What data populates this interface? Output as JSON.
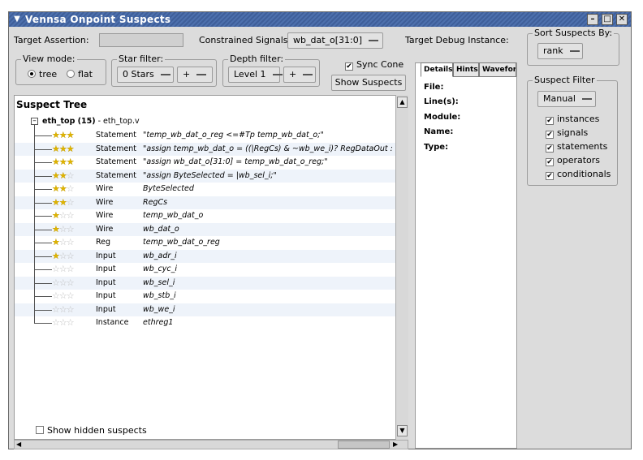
{
  "window": {
    "title": "Vennsa Onpoint Suspects"
  },
  "toolbar": {
    "target_assertion_label": "Target Assertion:",
    "constrained_signals_label": "Constrained Signals:",
    "constrained_signals_value": "wb_dat_o[31:0]",
    "target_debug_label": "Target Debug Instance:"
  },
  "view_mode": {
    "title": "View mode:",
    "tree_label": "tree",
    "flat_label": "flat"
  },
  "star_filter": {
    "title": "Star filter:",
    "value": "0 Stars",
    "op": "+"
  },
  "depth_filter": {
    "title": "Depth filter:",
    "value": "Level 1",
    "op": "+"
  },
  "sync_cone_label": "Sync Cone",
  "show_suspects_label": "Show Suspects",
  "tree": {
    "title": "Suspect Tree",
    "root_name": "eth_top (15)",
    "root_file": " - eth_top.v",
    "rows": [
      {
        "stars": 3,
        "kind": "Statement",
        "name": "\"temp_wb_dat_o_reg <=#Tp temp_wb_dat_o;\""
      },
      {
        "stars": 3,
        "kind": "Statement",
        "name": "\"assign temp_wb_dat_o = ((|RegCs) & ~wb_we_i)? RegDataOut : BD"
      },
      {
        "stars": 3,
        "kind": "Statement",
        "name": "\"assign wb_dat_o[31:0] = temp_wb_dat_o_reg;\""
      },
      {
        "stars": 2,
        "kind": "Statement",
        "name": "\"assign ByteSelected = |wb_sel_i;\""
      },
      {
        "stars": 2,
        "kind": "Wire",
        "name": "ByteSelected"
      },
      {
        "stars": 2,
        "kind": "Wire",
        "name": "RegCs"
      },
      {
        "stars": 1,
        "kind": "Wire",
        "name": "temp_wb_dat_o"
      },
      {
        "stars": 1,
        "kind": "Wire",
        "name": "wb_dat_o"
      },
      {
        "stars": 1,
        "kind": "Reg",
        "name": "temp_wb_dat_o_reg"
      },
      {
        "stars": 1,
        "kind": "Input",
        "name": "wb_adr_i"
      },
      {
        "stars": 0,
        "kind": "Input",
        "name": "wb_cyc_i"
      },
      {
        "stars": 0,
        "kind": "Input",
        "name": "wb_sel_i"
      },
      {
        "stars": 0,
        "kind": "Input",
        "name": "wb_stb_i"
      },
      {
        "stars": 0,
        "kind": "Input",
        "name": "wb_we_i"
      },
      {
        "stars": 0,
        "kind": "Instance",
        "name": "ethreg1"
      }
    ],
    "show_hidden_label": "Show hidden suspects"
  },
  "details": {
    "tabs": [
      "Details",
      "Hints",
      "Waveform"
    ],
    "labels": [
      "File:",
      "Line(s):",
      "Module:",
      "Name:",
      "Type:"
    ]
  },
  "sort": {
    "title": "Sort Suspects By:",
    "value": "rank"
  },
  "suspect_filter": {
    "title": "Suspect Filter",
    "mode": "Manual",
    "items": [
      "instances",
      "signals",
      "statements",
      "operators",
      "conditionals"
    ]
  }
}
